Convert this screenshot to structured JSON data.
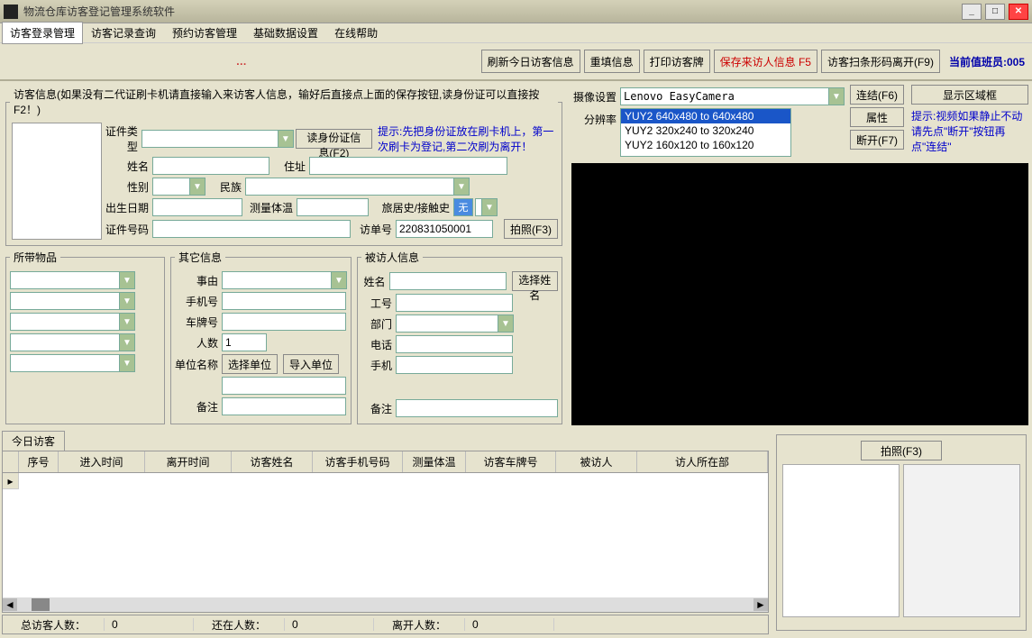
{
  "window": {
    "title": "物流仓库访客登记管理系统软件"
  },
  "menu": {
    "items": [
      "访客登录管理",
      "访客记录查询",
      "预约访客管理",
      "基础数据设置",
      "在线帮助"
    ],
    "active": 0
  },
  "toolbar": {
    "ellipsis": "…",
    "refresh": "刷新今日访客信息",
    "refill": "重填信息",
    "print": "打印访客牌",
    "save": "保存来访人信息 F5",
    "scan_leave": "访客扫条形码离开(F9)",
    "staff_label": "当前值班员:005"
  },
  "visitor": {
    "legend": "访客信息(如果没有二代证刷卡机请直接输入来访客人信息，输好后直接点上面的保存按钮,读身份证可以直接按F2！)",
    "id_type_label": "证件类型",
    "read_id_btn": "读身份证信息(F2)",
    "hint": "提示:先把身份证放在刷卡机上，第一次刷卡为登记,第二次刷为离开！",
    "name_label": "姓名",
    "addr_label": "住址",
    "gender_label": "性别",
    "ethnic_label": "民族",
    "dob_label": "出生日期",
    "temp_label": "测量体温",
    "travel_label": "旅居史/接触史",
    "idnum_label": "证件号码",
    "visitno_label": "访单号",
    "visitno_value": "220831050001",
    "photo_btn": "拍照(F3)"
  },
  "items": {
    "legend": "所带物品"
  },
  "other": {
    "legend": "其它信息",
    "reason_label": "事由",
    "phone_label": "手机号",
    "car_label": "车牌号",
    "count_label": "人数",
    "count_value": "1",
    "unit_label": "单位名称",
    "select_unit_btn": "选择单位",
    "import_unit_btn": "导入单位",
    "note_label": "备注"
  },
  "host": {
    "legend": "被访人信息",
    "name_label": "姓名",
    "select_name_btn": "选择姓名",
    "emp_label": "工号",
    "dept_label": "部门",
    "tel_label": "电话",
    "mobile_label": "手机",
    "note_label": "备注"
  },
  "camera": {
    "device_label": "摄像设置",
    "device_value": "Lenovo EasyCamera",
    "res_label": "分辨率",
    "res_options": [
      "YUY2 640x480 to 640x480",
      "YUY2 320x240 to 320x240",
      "YUY2 160x120 to 160x120"
    ],
    "res_selected": 0,
    "connect_btn": "连结(F6)",
    "prop_btn": "属性",
    "disconnect_btn": "断开(F7)",
    "area_btn": "显示区域框",
    "hint": "提示:视频如果静止不动请先点\"断开\"按钮再点\"连结\""
  },
  "today": {
    "tab": "今日访客",
    "headers": [
      "序号",
      "进入时间",
      "离开时间",
      "访客姓名",
      "访客手机号码",
      "测量体温",
      "访客车牌号",
      "被访人",
      "访人所在部"
    ],
    "stats": {
      "total_label": "总访客人数：",
      "total_value": "0",
      "present_label": "还在人数：",
      "present_value": "0",
      "left_label": "离开人数：",
      "left_value": "0"
    }
  },
  "snapshot": {
    "btn": "拍照(F3)"
  }
}
